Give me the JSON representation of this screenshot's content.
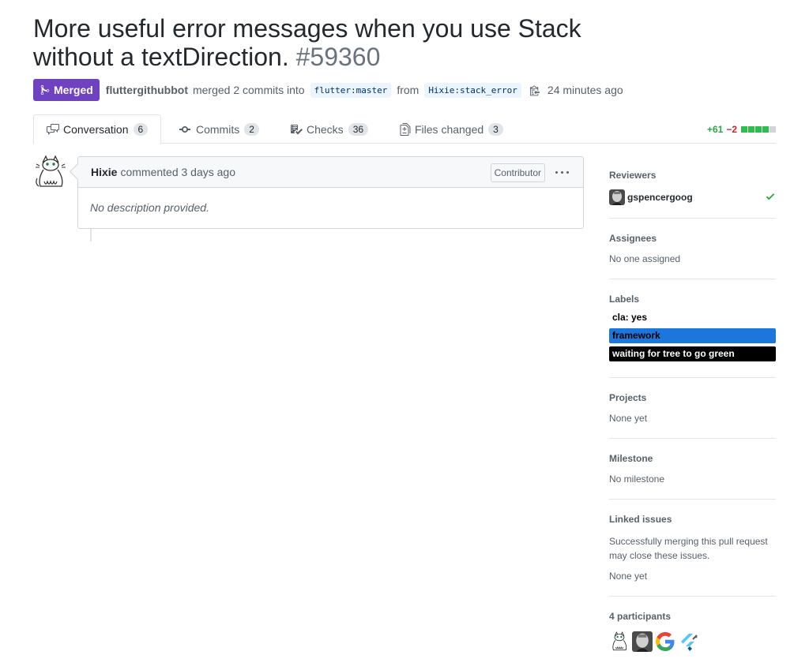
{
  "pr": {
    "title_line1": "More useful error messages when you use Stack",
    "title_line2": "without a textDirection.",
    "number": "#59360",
    "state": "Merged",
    "state_color": "#6f42c1",
    "merger": "fluttergithubbot",
    "merge_text": "merged 2 commits into",
    "base_branch": "flutter:master",
    "from_text": "from",
    "head_branch": "Hixie:stack_error",
    "time": "24 minutes ago"
  },
  "tabs": [
    {
      "label": "Conversation",
      "count": "6",
      "icon": "comment-discussion-icon"
    },
    {
      "label": "Commits",
      "count": "2",
      "icon": "git-commit-icon"
    },
    {
      "label": "Checks",
      "count": "36",
      "icon": "checklist-icon"
    },
    {
      "label": "Files changed",
      "count": "3",
      "icon": "diff-icon"
    }
  ],
  "diffstat": {
    "additions": "+61",
    "deletions": "−2",
    "add_color": "#28a745",
    "del_color": "#cb2431"
  },
  "comment": {
    "author": "Hixie",
    "time_text": "commented 3 days ago",
    "role": "Contributor",
    "body": "No description provided."
  },
  "sidebar": {
    "reviewers": {
      "heading": "Reviewers",
      "name": "gspencergoog",
      "status": "approved"
    },
    "assignees": {
      "heading": "Assignees",
      "value": "No one assigned"
    },
    "labels": {
      "heading": "Labels",
      "items": [
        {
          "name": "cla: yes",
          "color": "#ffffff",
          "text_color": "#000000"
        },
        {
          "name": "framework",
          "color": "#1d76db",
          "text_color": "#000000"
        },
        {
          "name": "waiting for tree to go green",
          "color": "#000000",
          "text_color": "#ffffff"
        }
      ]
    },
    "projects": {
      "heading": "Projects",
      "value": "None yet"
    },
    "milestone": {
      "heading": "Milestone",
      "value": "No milestone"
    },
    "linked": {
      "heading": "Linked issues",
      "desc": "Successfully merging this pull request may close these issues.",
      "value": "None yet"
    },
    "participants": {
      "heading": "4 participants"
    }
  }
}
